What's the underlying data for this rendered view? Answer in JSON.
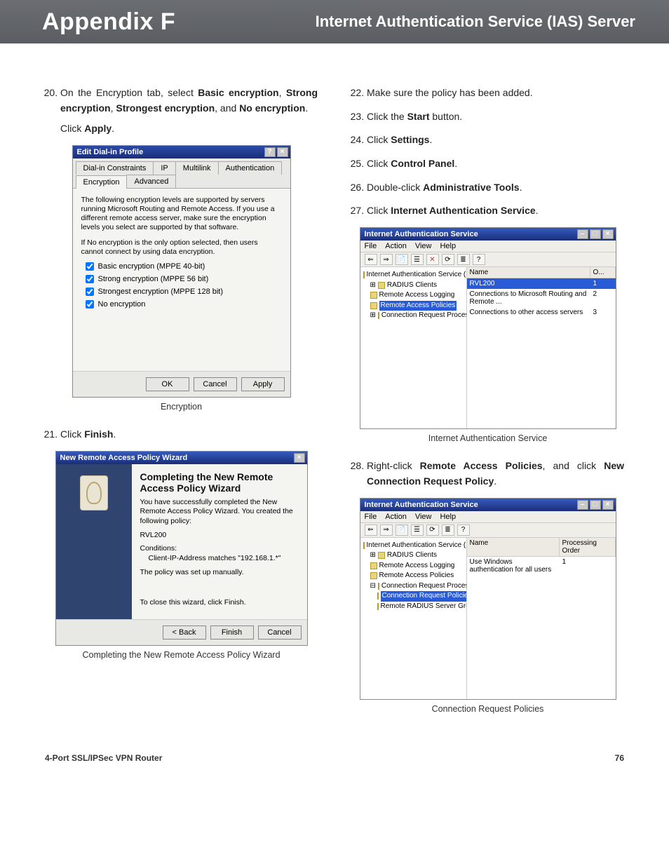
{
  "header": {
    "appendix": "Appendix F",
    "title": "Internet Authentication Service (IAS) Server"
  },
  "footer": {
    "product": "4-Port SSL/IPSec VPN Router",
    "page": "76"
  },
  "steps": {
    "s20a": "On the Encryption tab, select ",
    "s20b1": "Basic encryption",
    "s20c": ", ",
    "s20b2": "Strong encryption",
    "s20d": ", ",
    "s20b3": "Strongest encryption",
    "s20e": ", and ",
    "s20b4": "No encryption",
    "s20f": ".",
    "s20g": "Click ",
    "s20h": "Apply",
    "s20i": ".",
    "s21a": "Click ",
    "s21b": "Finish",
    "s21c": ".",
    "s22": "Make sure the policy has been added.",
    "s23a": "Click the ",
    "s23b": "Start",
    "s23c": " button.",
    "s24a": "Click ",
    "s24b": "Settings",
    "s24c": ".",
    "s25a": "Click ",
    "s25b": "Control Panel",
    "s25c": ".",
    "s26a": "Double-click ",
    "s26b": "Administrative Tools",
    "s26c": ".",
    "s27a": "Click ",
    "s27b": "Internet Authentication Service",
    "s27c": ".",
    "s28a": "Right-click ",
    "s28b": "Remote Access Policies",
    "s28c": ", and click ",
    "s28d": "New Connection Request Policy",
    "s28e": "."
  },
  "dlg1": {
    "title": "Edit Dial-in Profile",
    "tabs": [
      "Dial-in Constraints",
      "IP",
      "Multilink",
      "Authentication",
      "Encryption",
      "Advanced"
    ],
    "para1": "The following encryption levels are supported by servers running Microsoft Routing and Remote Access. If you use a different remote access server, make sure the encryption levels you select are supported by that software.",
    "para2": "If No encryption is the only option selected, then users cannot connect by using data encryption.",
    "chk": [
      "Basic encryption (MPPE 40-bit)",
      "Strong encryption (MPPE 56 bit)",
      "Strongest encryption (MPPE 128 bit)",
      "No encryption"
    ],
    "btns": [
      "OK",
      "Cancel",
      "Apply"
    ],
    "caption": "Encryption"
  },
  "wiz": {
    "title": "New Remote Access Policy Wizard",
    "h": "Completing the New Remote Access Policy Wizard",
    "p1": "You have successfully completed the New Remote Access Policy Wizard. You created the following policy:",
    "policy": "RVL200",
    "condlabel": "Conditions:",
    "cond": "Client-IP-Address matches \"192.168.1.*\"",
    "p2": "The policy was set up manually.",
    "p3": "To close this wizard, click Finish.",
    "btns": [
      "< Back",
      "Finish",
      "Cancel"
    ],
    "caption": "Completing the New Remote Access Policy Wizard"
  },
  "mmc": {
    "title": "Internet Authentication Service",
    "menus": [
      "File",
      "Action",
      "View",
      "Help"
    ],
    "tree1": [
      "Internet Authentication Service (Local)",
      "RADIUS Clients",
      "Remote Access Logging",
      "Remote Access Policies",
      "Connection Request Processing"
    ],
    "listhdr1": [
      "Name",
      "O..."
    ],
    "rows1": [
      {
        "name": "RVL200",
        "o": "1",
        "sel": true
      },
      {
        "name": "Connections to Microsoft Routing and Remote ...",
        "o": "2"
      },
      {
        "name": "Connections to other access servers",
        "o": "3"
      }
    ],
    "caption1": "Internet Authentication Service",
    "tree2": [
      "Internet Authentication Service (Local)",
      "RADIUS Clients",
      "Remote Access Logging",
      "Remote Access Policies",
      "Connection Request Processing",
      "Connection Request Policies",
      "Remote RADIUS Server Groups"
    ],
    "listhdr2": [
      "Name",
      "Processing Order"
    ],
    "rows2": [
      {
        "name": "Use Windows authentication for all users",
        "o": "1"
      }
    ],
    "caption2": "Connection Request Policies"
  }
}
